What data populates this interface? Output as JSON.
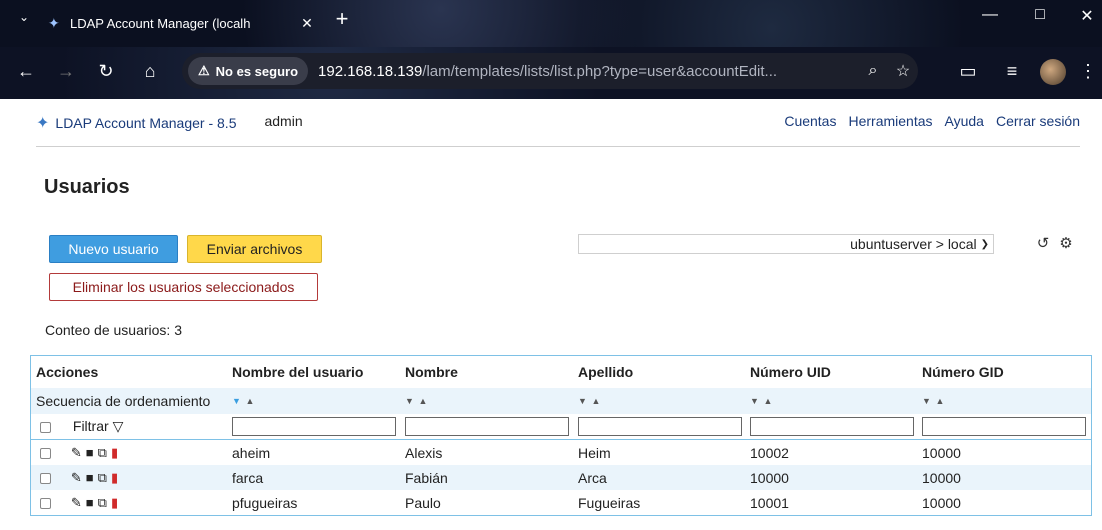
{
  "browser": {
    "tab_title": "LDAP Account Manager (localh",
    "security_chip": "No es seguro",
    "url_host": "192.168.18.139",
    "url_path": "/lam/templates/lists/list.php?type=user&accountEdit..."
  },
  "header": {
    "brand": "LDAP Account Manager - 8.5",
    "user": "admin",
    "nav": [
      "Cuentas",
      "Herramientas",
      "Ayuda",
      "Cerrar sesión"
    ]
  },
  "page": {
    "title": "Usuarios",
    "new_user_label": "Nuevo usuario",
    "upload_label": "Enviar archivos",
    "delete_selected_label": "Eliminar los usuarios seleccionados",
    "count_text": "Conteo de usuarios: 3",
    "suffix_value": "ubuntuserver > local"
  },
  "table": {
    "columns": [
      "Acciones",
      "Nombre del usuario",
      "Nombre",
      "Apellido",
      "Número UID",
      "Número GID"
    ],
    "sort_label": "Secuencia de ordenamiento",
    "filter_label": "Filtrar",
    "rows": [
      {
        "uid": "aheim",
        "given": "Alexis",
        "sn": "Heim",
        "uidnum": "10002",
        "gidnum": "10000"
      },
      {
        "uid": "farca",
        "given": "Fabián",
        "sn": "Arca",
        "uidnum": "10000",
        "gidnum": "10000"
      },
      {
        "uid": "pfugueiras",
        "given": "Paulo",
        "sn": "Fugueiras",
        "uidnum": "10001",
        "gidnum": "10000"
      }
    ]
  },
  "colors": {
    "primary_button": "#3f9de0",
    "upload_button": "#ffd84a",
    "delete_border": "#b33a3a",
    "table_border": "#7ec1e6",
    "row_alt": "#eaf4fb"
  },
  "icons": [
    "tab-dropdown-icon",
    "ldap-logo-icon",
    "close-icon",
    "new-tab-icon",
    "minimize-icon",
    "maximize-icon",
    "window-close-icon",
    "back-icon",
    "forward-icon",
    "reload-icon",
    "home-icon",
    "warning-icon",
    "zoom-icon",
    "star-icon",
    "extensions-icon",
    "reading-list-icon",
    "menu-icon",
    "refresh-icon",
    "settings-icon",
    "filter-icon",
    "edit-icon",
    "delete-icon",
    "copy-icon",
    "pdf-icon"
  ]
}
